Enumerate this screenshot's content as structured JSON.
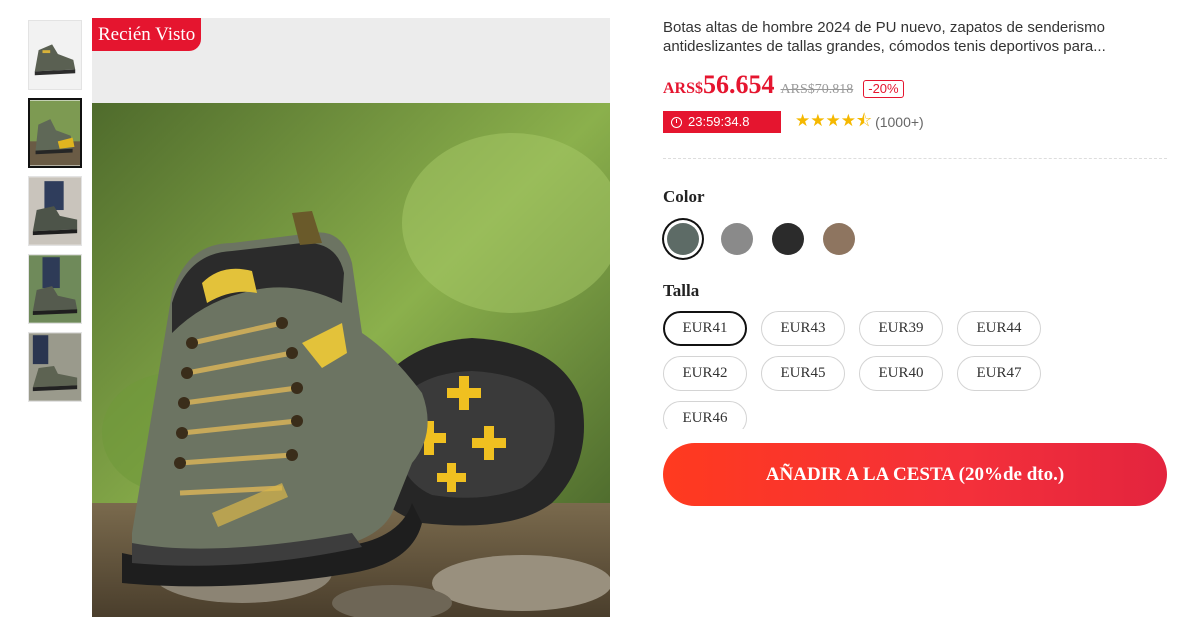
{
  "badge": "Recién Visto",
  "product": {
    "title": "Botas altas de hombre 2024 de PU nuevo, zapatos de senderismo antideslizantes de tallas grandes, cómodos tenis deportivos para...",
    "currency": "ARS$",
    "price": "56.654",
    "old_price": "ARS$70.818",
    "discount": "-20%",
    "timer": "23:59:34.8",
    "stars": "★★★★⯪",
    "rating_count": "(1000+)"
  },
  "color_section": {
    "label": "Color",
    "swatches": [
      {
        "name": "olive-gray",
        "color": "#5d6b66"
      },
      {
        "name": "gray",
        "color": "#8a8a8a"
      },
      {
        "name": "black",
        "color": "#2b2b2b"
      },
      {
        "name": "brown",
        "color": "#8e7560"
      }
    ]
  },
  "size_section": {
    "label": "Talla",
    "options": [
      "EUR41",
      "EUR43",
      "EUR39",
      "EUR44",
      "EUR42",
      "EUR45",
      "EUR40",
      "EUR47",
      "EUR46"
    ],
    "selected": "EUR41"
  },
  "cart_button": "AÑADIR A LA CESTA  (20%de dto.)",
  "colors": {
    "accent": "#e5152f",
    "star": "#f5b800"
  }
}
